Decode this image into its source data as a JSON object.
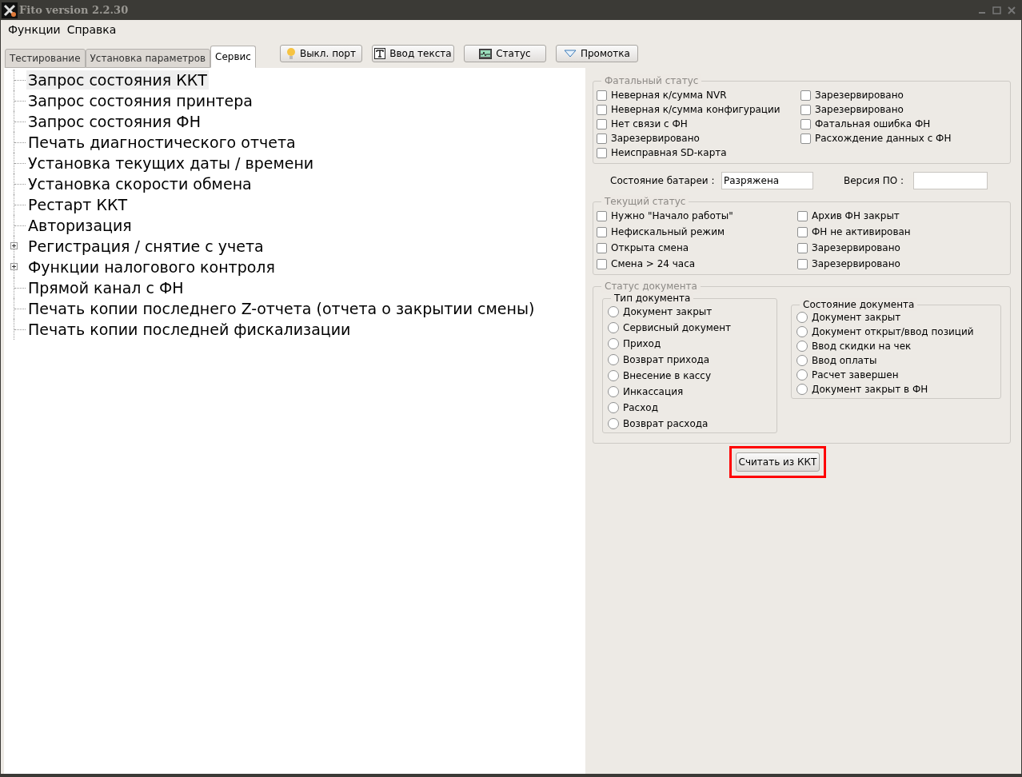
{
  "window": {
    "title": "Fito version 2.2.30"
  },
  "menu": [
    "Функции",
    "Справка"
  ],
  "tabs": [
    {
      "label": "Тестирование",
      "selected": false
    },
    {
      "label": "Установка параметров",
      "selected": false
    },
    {
      "label": "Сервис",
      "selected": true
    }
  ],
  "toolbar": [
    {
      "kind": "bulb",
      "label": "Выкл. порт"
    },
    {
      "kind": "text",
      "label": "Ввод текста"
    },
    {
      "kind": "monitor",
      "label": "Статус"
    },
    {
      "kind": "triangle",
      "label": "Промотка"
    }
  ],
  "tree": [
    {
      "label": "Запрос состояния ККТ",
      "kind": "leaf",
      "selected": true
    },
    {
      "label": "Запрос состояния принтера",
      "kind": "leaf",
      "selected": false
    },
    {
      "label": "Запрос состояния ФН",
      "kind": "leaf",
      "selected": false
    },
    {
      "label": "Печать диагностического отчета",
      "kind": "leaf",
      "selected": false
    },
    {
      "label": "Установка текущих даты / времени",
      "kind": "leaf",
      "selected": false
    },
    {
      "label": "Установка скорости обмена",
      "kind": "leaf",
      "selected": false
    },
    {
      "label": "Рестарт ККТ",
      "kind": "leaf",
      "selected": false
    },
    {
      "label": "Авторизация",
      "kind": "leaf",
      "selected": false
    },
    {
      "label": "Регистрация / снятие с учета",
      "kind": "group",
      "expanded": false,
      "selected": false
    },
    {
      "label": "Функции налогового контроля",
      "kind": "group",
      "expanded": false,
      "selected": false
    },
    {
      "label": "Прямой канал с ФН",
      "kind": "leaf",
      "selected": false
    },
    {
      "label": "Печать копии последнего Z-отчета (отчета о закрытии смены)",
      "kind": "leaf",
      "selected": false
    },
    {
      "label": "Печать копии последней фискализации",
      "kind": "leaf",
      "selected": false
    }
  ],
  "fatal_status": {
    "title": "Фатальный статус",
    "left": [
      {
        "label": "Неверная к/сумма NVR",
        "checked": false
      },
      {
        "label": "Неверная к/сумма конфигурации",
        "checked": false
      },
      {
        "label": "Нет связи с ФН",
        "checked": false
      },
      {
        "label": "Зарезервировано",
        "checked": false
      },
      {
        "label": "Неисправная SD-карта",
        "checked": false
      }
    ],
    "right": [
      {
        "label": "Зарезервировано",
        "checked": false
      },
      {
        "label": "Зарезервировано",
        "checked": false
      },
      {
        "label": "Фатальная ошибка ФН",
        "checked": false
      },
      {
        "label": "Расхождение данных с ФН",
        "checked": false
      }
    ]
  },
  "battery": {
    "label": "Состояние батареи :",
    "value": "Разряжена"
  },
  "firmware": {
    "label": "Версия ПО :"
  },
  "current_status": {
    "title": "Текущий статус",
    "left": [
      {
        "label": "Нужно \"Начало работы\"",
        "checked": false
      },
      {
        "label": "Нефискальный режим",
        "checked": false
      },
      {
        "label": "Открыта смена",
        "checked": false
      },
      {
        "label": "Смена > 24 часа",
        "checked": false
      }
    ],
    "right": [
      {
        "label": "Архив ФН закрыт",
        "checked": false
      },
      {
        "label": "ФН не активирован",
        "checked": false
      },
      {
        "label": "Зарезервировано",
        "checked": false
      },
      {
        "label": "Зарезервировано",
        "checked": false
      }
    ]
  },
  "document_status": {
    "title": "Статус документа",
    "type": {
      "title": "Тип документа",
      "options": [
        {
          "label": "Документ закрыт",
          "selected": false
        },
        {
          "label": "Сервисный документ",
          "selected": false
        },
        {
          "label": "Приход",
          "selected": false
        },
        {
          "label": "Возврат прихода",
          "selected": false
        },
        {
          "label": "Внесение в кассу",
          "selected": false
        },
        {
          "label": "Инкассация",
          "selected": false
        },
        {
          "label": "Расход",
          "selected": false
        },
        {
          "label": "Возврат расхода",
          "selected": false
        }
      ]
    },
    "state": {
      "title": "Состояние документа",
      "options": [
        {
          "label": "Документ закрыт",
          "selected": false
        },
        {
          "label": "Документ открыт/ввод позиций",
          "selected": false
        },
        {
          "label": "Ввод скидки на чек",
          "selected": false
        },
        {
          "label": "Ввод оплаты",
          "selected": false
        },
        {
          "label": "Расчет завершен",
          "selected": false
        },
        {
          "label": "Документ закрыт в ФН",
          "selected": false
        }
      ]
    }
  },
  "read_button": {
    "label": "Считать из ККТ",
    "highlighted": true
  }
}
